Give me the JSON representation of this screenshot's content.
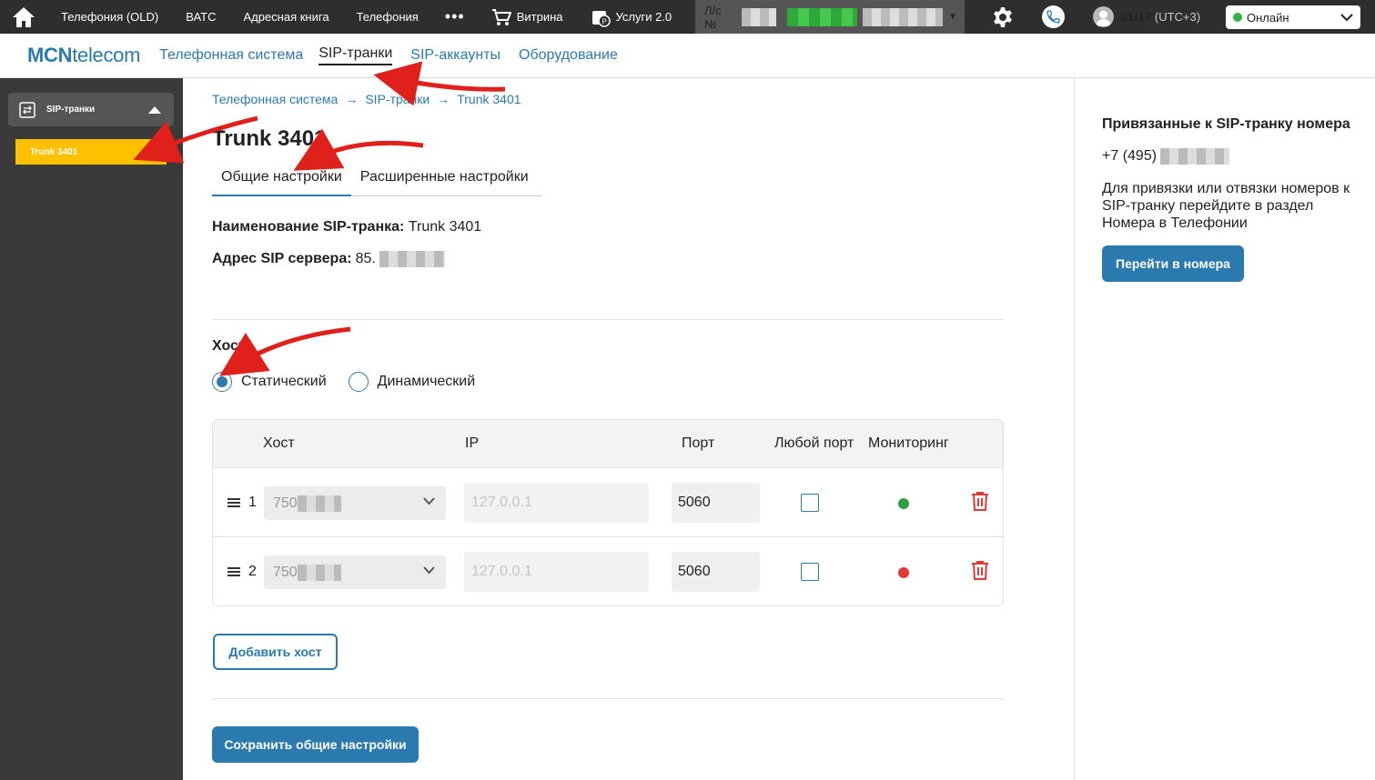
{
  "topbar": {
    "items": [
      "Телефония (OLD)",
      "ВАТС",
      "Адресная книга",
      "Телефония"
    ],
    "more": "•••",
    "shop": "Витрина",
    "services": "Услуги 2.0",
    "account_label": "Л/с №",
    "time": "21:17",
    "timezone": "(UTC+3)",
    "status": "Онлайн",
    "status_color": "#2fb344"
  },
  "nav": {
    "logo_bold": "MCN",
    "logo_rest": "telecom",
    "links": [
      "Телефонная система",
      "SIP-транки",
      "SIP-аккаунты",
      "Оборудование"
    ]
  },
  "sidebar": {
    "section": "SIP-транки",
    "items": [
      "Trunk 3401"
    ]
  },
  "main": {
    "breadcrumb": [
      "Телефонная система",
      "SIP-транки",
      "Trunk 3401"
    ],
    "breadcrumb_sep": "→",
    "title": "Trunk 3401",
    "tabs": [
      "Общие настройки",
      "Расширенные настройки"
    ],
    "name_label": "Наименование SIP-транка:",
    "name_value": "Trunk 3401",
    "server_label": "Адрес SIP сервера:",
    "server_value": "85.",
    "host_label": "Хост",
    "host_options": [
      "Статический",
      "Динамический"
    ],
    "table": {
      "headers": [
        "Хост",
        "IP",
        "Порт",
        "Любой порт",
        "Мониторинг"
      ],
      "rows": [
        {
          "num": "1",
          "host": "750",
          "ip": "127.0.0.1",
          "port": "5060",
          "monitor_color": "#2ea043"
        },
        {
          "num": "2",
          "host": "750",
          "ip": "127.0.0.1",
          "port": "5060",
          "monitor_color": "#e53935"
        }
      ]
    },
    "add_host": "Добавить хост",
    "save": "Сохранить общие настройки"
  },
  "right": {
    "title": "Привязанные к SIP-транку номера",
    "phone_prefix": "+7 (495)",
    "text": "Для привязки или отвязки номеров к SIP-транку перейдите в раздел Номера в Телефонии",
    "button": "Перейти в номера"
  },
  "colors": {
    "accent": "#2a7ab0",
    "sidebar_active": "#ffc000",
    "topbar": "#2e2e2e",
    "annotation": "#e0201b"
  }
}
